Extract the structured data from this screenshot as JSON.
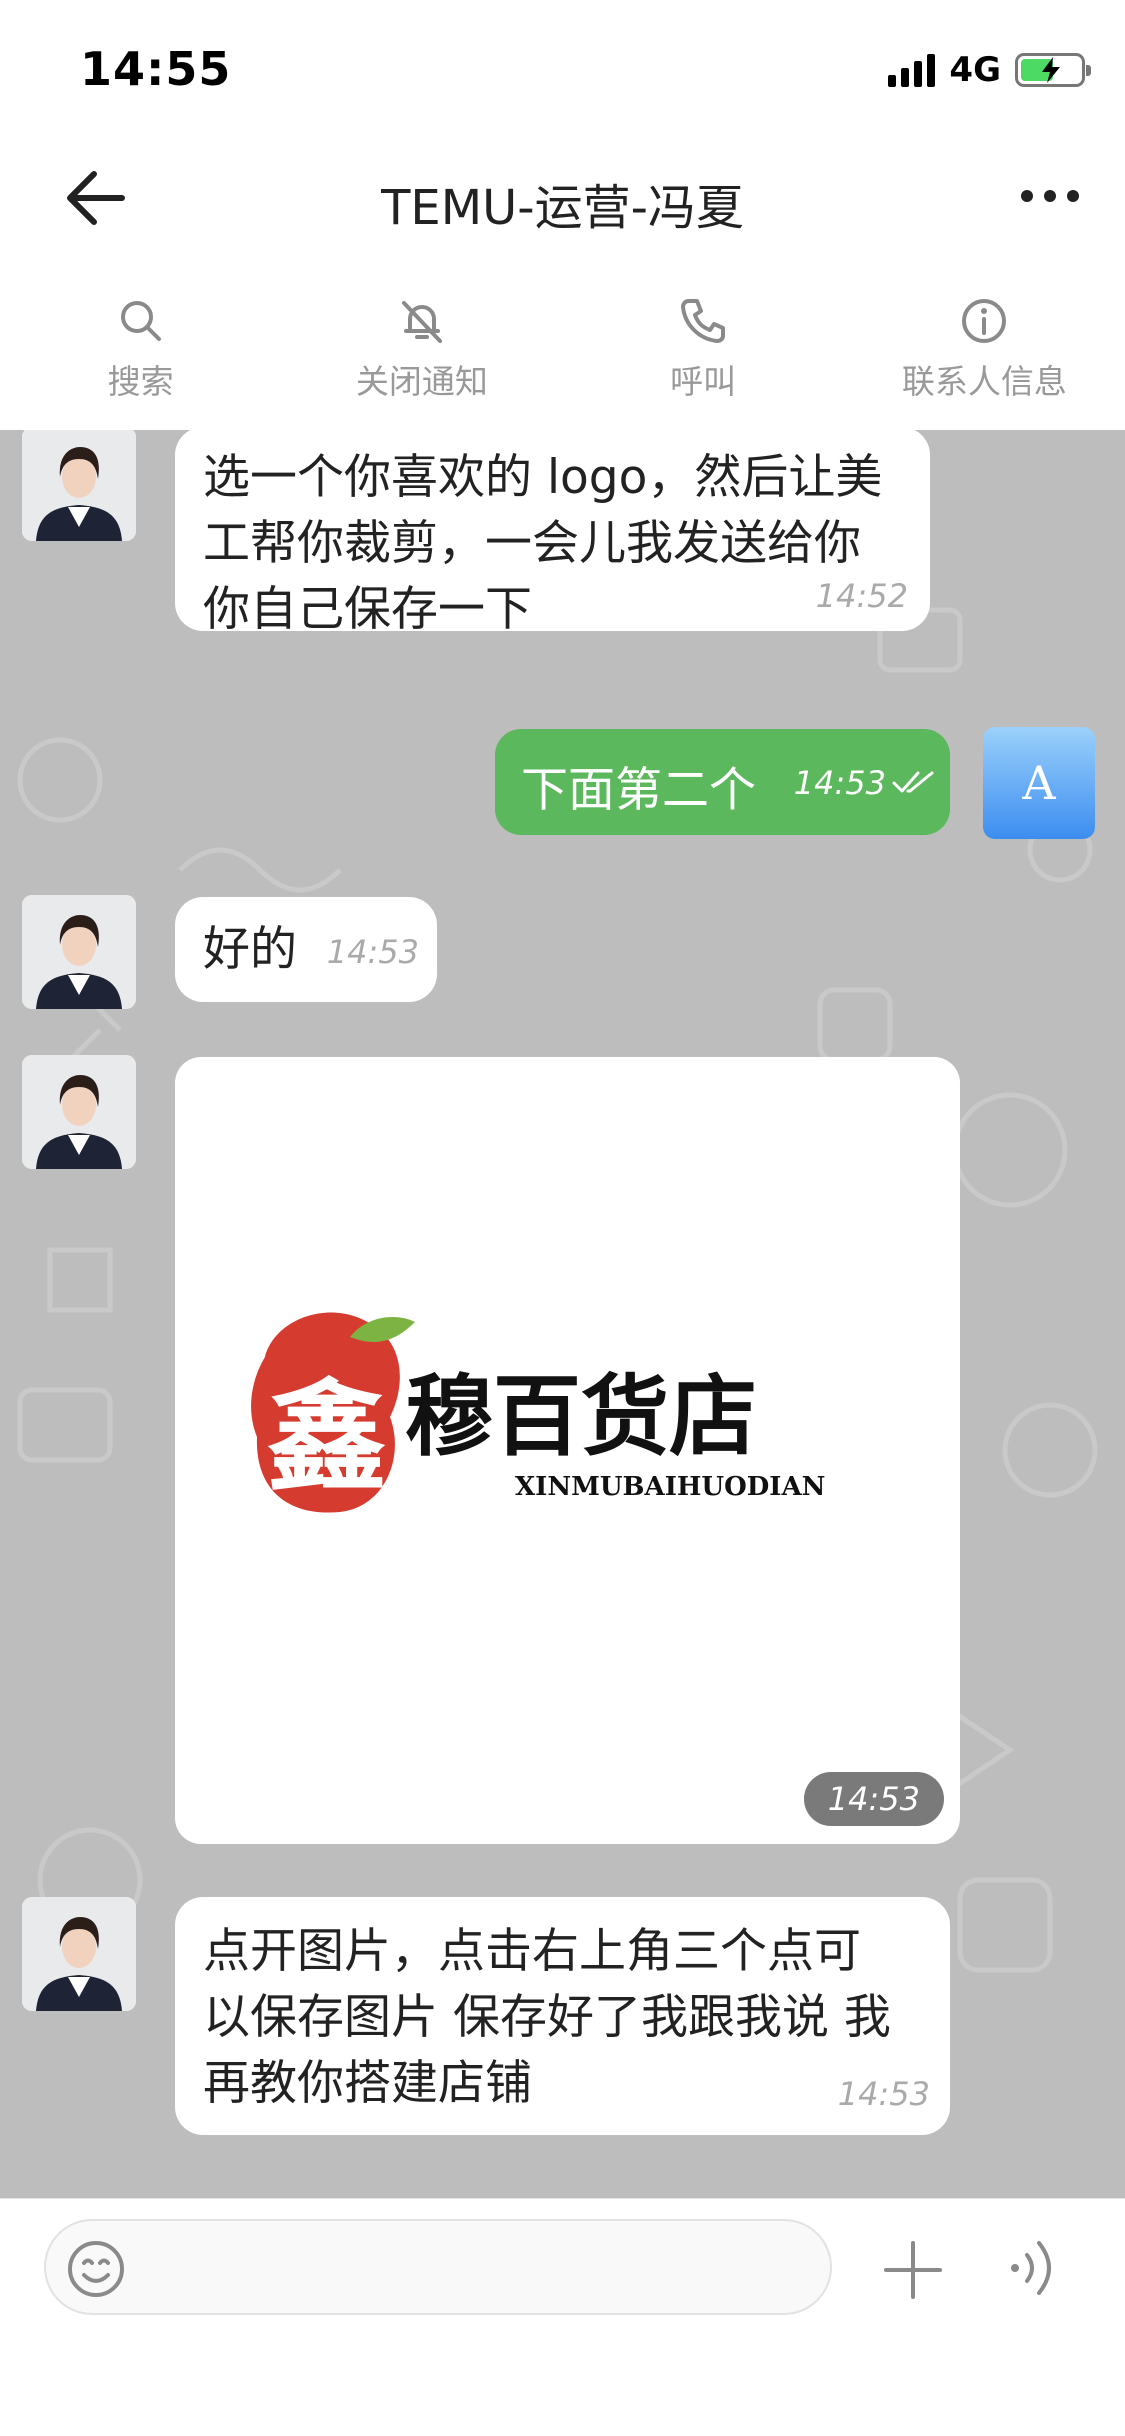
{
  "status_bar": {
    "time": "14:55",
    "network": "4G",
    "battery_level": 0.55,
    "battery_color": "#4cd964"
  },
  "header": {
    "title": "TEMU-运营-冯夏",
    "back_icon": "arrow-left-icon",
    "more_icon": "more-horizontal-icon"
  },
  "toolbar": {
    "items": [
      {
        "label": "搜索",
        "icon": "search-icon"
      },
      {
        "label": "关闭通知",
        "icon": "bell-off-icon"
      },
      {
        "label": "呼叫",
        "icon": "phone-icon"
      },
      {
        "label": "联系人信息",
        "icon": "info-icon"
      }
    ]
  },
  "messages": [
    {
      "direction": "in",
      "type": "text",
      "lines": [
        "选一个你喜欢的 logo，然后让美",
        "工帮你裁剪，一会儿我发送给你",
        "你自己保存一下"
      ],
      "time": "14:52"
    },
    {
      "direction": "out",
      "type": "text",
      "text": "下面第二个",
      "time": "14:53",
      "status": "read",
      "avatar_letter": "A"
    },
    {
      "direction": "in",
      "type": "text",
      "lines": [
        "好的"
      ],
      "time": "14:53"
    },
    {
      "direction": "in",
      "type": "image",
      "time": "14:53",
      "image": {
        "logo_glyph": "鑫",
        "brand_text": "穆百货店",
        "brand_caption": "XINMUBAIHUODIAN"
      }
    },
    {
      "direction": "in",
      "type": "text",
      "lines": [
        "点开图片，点击右上角三个点可",
        "以保存图片 保存好了我跟我说 我",
        "再教你搭建店铺"
      ],
      "time": "14:53"
    }
  ],
  "input_bar": {
    "placeholder": "",
    "value": "",
    "emoji_icon": "emoji-icon",
    "plus_icon": "plus-icon",
    "voice_icon": "voice-icon"
  },
  "colors": {
    "chat_background": "#bdbdbd",
    "outgoing_bubble": "#5cb85c",
    "incoming_bubble": "#ffffff",
    "toolbar_label": "#999999",
    "logo_red": "#d63b2f",
    "logo_leaf": "#7cb342"
  }
}
